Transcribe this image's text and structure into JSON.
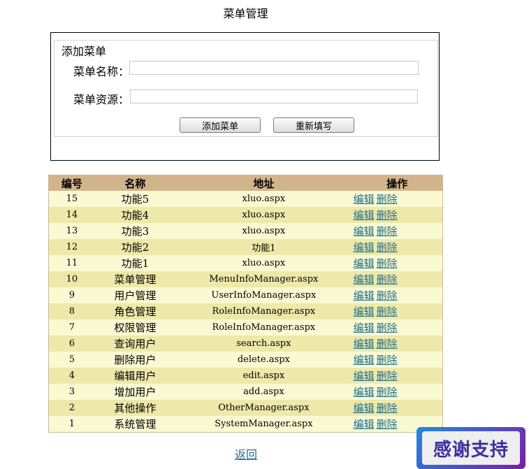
{
  "page": {
    "title": "菜单管理",
    "back_link": "返回",
    "thanks_badge": "感谢支持"
  },
  "form": {
    "legend": "添加菜单",
    "name_label": "菜单名称：",
    "name_value": "",
    "resource_label": "菜单资源：",
    "resource_value": "",
    "add_button": "添加菜单",
    "reset_button": "重新填写"
  },
  "table": {
    "headers": [
      "编号",
      "名称",
      "地址",
      "操作"
    ],
    "rows": [
      {
        "id": "15",
        "name": "功能5",
        "address": "xluo.aspx",
        "edit": "编辑",
        "delete": "删除"
      },
      {
        "id": "14",
        "name": "功能4",
        "address": "xluo.aspx",
        "edit": "编辑",
        "delete": "删除"
      },
      {
        "id": "13",
        "name": "功能3",
        "address": "xluo.aspx",
        "edit": "编辑",
        "delete": "删除"
      },
      {
        "id": "12",
        "name": "功能2",
        "address": "功能1",
        "edit": "编辑",
        "delete": "删除"
      },
      {
        "id": "11",
        "name": "功能1",
        "address": "xluo.aspx",
        "edit": "编辑",
        "delete": "删除"
      },
      {
        "id": "10",
        "name": "菜单管理",
        "address": "MenuInfoManager.aspx",
        "edit": "编辑",
        "delete": "删除"
      },
      {
        "id": "9",
        "name": "用户管理",
        "address": "UserInfoManager.aspx",
        "edit": "编辑",
        "delete": "删除"
      },
      {
        "id": "8",
        "name": "角色管理",
        "address": "RoleInfoManager.aspx",
        "edit": "编辑",
        "delete": "删除"
      },
      {
        "id": "7",
        "name": "权限管理",
        "address": "RoleInfoManager.aspx",
        "edit": "编辑",
        "delete": "删除"
      },
      {
        "id": "6",
        "name": "查询用户",
        "address": "search.aspx",
        "edit": "编辑",
        "delete": "删除"
      },
      {
        "id": "5",
        "name": "删除用户",
        "address": "delete.aspx",
        "edit": "编辑",
        "delete": "删除"
      },
      {
        "id": "4",
        "name": "编辑用户",
        "address": "edit.aspx",
        "edit": "编辑",
        "delete": "删除"
      },
      {
        "id": "3",
        "name": "增加用户",
        "address": "add.aspx",
        "edit": "编辑",
        "delete": "删除"
      },
      {
        "id": "2",
        "name": "其他操作",
        "address": "OtherManager.aspx",
        "edit": "编辑",
        "delete": "删除"
      },
      {
        "id": "1",
        "name": "系统管理",
        "address": "SystemManager.aspx",
        "edit": "编辑",
        "delete": "删除"
      }
    ]
  },
  "colors": {
    "header_bg": "#d2b48c",
    "row_odd": "#fafad2",
    "row_even": "#eee8aa",
    "link": "#1f6e8c"
  }
}
